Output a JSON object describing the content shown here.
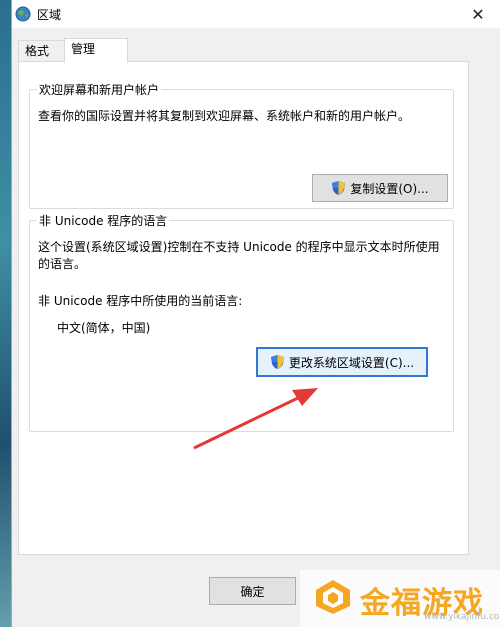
{
  "window": {
    "title": "区域",
    "close_glyph": "✕"
  },
  "tabs": [
    {
      "label": "格式"
    },
    {
      "label": "管理"
    }
  ],
  "welcome_group": {
    "title": "欢迎屏幕和新用户帐户",
    "description": "查看你的国际设置并将其复制到欢迎屏幕、系统帐户和新的用户帐户。",
    "copy_button": "复制设置(O)..."
  },
  "nonunicode_group": {
    "title": "非 Unicode 程序的语言",
    "description": "这个设置(系统区域设置)控制在不支持 Unicode 的程序中显示文本时所使用的语言。",
    "current_label": "非 Unicode 程序中所使用的当前语言:",
    "current_value": "中文(简体，中国)",
    "change_button": "更改系统区域设置(C)..."
  },
  "footer": {
    "ok_button": "确定"
  },
  "watermark": {
    "text": "金福游戏",
    "url": "www.yikajinfu.com"
  },
  "colors": {
    "arrow": "#e53935",
    "focus_border": "#2f78d4",
    "watermark": "#f5a623"
  },
  "icons": {
    "window": "globe-icon",
    "shield": "uac-shield-icon",
    "watermark": "watermark-logo-icon"
  }
}
